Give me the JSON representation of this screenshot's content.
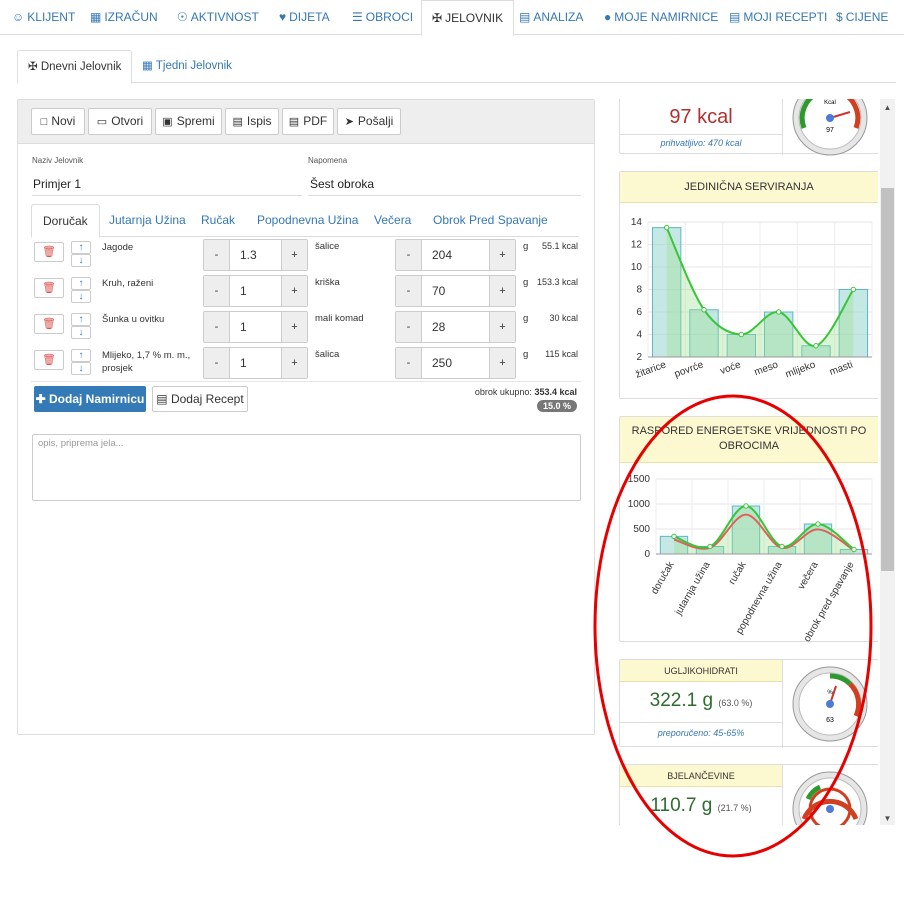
{
  "topnav": [
    {
      "label": "KLIJENT",
      "icon": "user-icon"
    },
    {
      "label": "IZRAČUN",
      "icon": "calculator-icon"
    },
    {
      "label": "AKTIVNOST",
      "icon": "bicycle-icon"
    },
    {
      "label": "DIJETA",
      "icon": "heartbeat-icon"
    },
    {
      "label": "OBROCI",
      "icon": "list-icon"
    },
    {
      "label": "JELOVNIK",
      "icon": "cutlery-icon"
    },
    {
      "label": "ANALIZA",
      "icon": "bar-chart-icon"
    },
    {
      "label": "MOJE NAMIRNICE",
      "icon": "apple-icon"
    },
    {
      "label": "MOJI RECEPTI",
      "icon": "file-icon"
    },
    {
      "label": "CIJENE",
      "icon": "dollar-icon"
    }
  ],
  "subtabs": [
    "Dnevni Jelovnik",
    "Tjedni Jelovnik"
  ],
  "toolbar": {
    "novi": "Novi",
    "otvori": "Otvori",
    "spremi": "Spremi",
    "ispis": "Ispis",
    "pdf": "PDF",
    "posalji": "Pošalji"
  },
  "form": {
    "naziv_label": "Naziv Jelovnik",
    "naziv_value": "Primjer 1",
    "napomena_label": "Napomena",
    "napomena_value": "Šest obroka"
  },
  "meal_tabs": [
    "Doručak",
    "Jutarnja Užina",
    "Ručak",
    "Popodnevna Užina",
    "Večera",
    "Obrok Pred Spavanje"
  ],
  "foods": [
    {
      "name": "Jagode",
      "qty": "1.3",
      "unit": "šalice",
      "grams": "204",
      "g": "g",
      "kcal": "55.1 kcal"
    },
    {
      "name": "Kruh, raženi",
      "qty": "1",
      "unit": "kriška",
      "grams": "70",
      "g": "g",
      "kcal": "153.3 kcal"
    },
    {
      "name": "Šunka u ovitku",
      "qty": "1",
      "unit": "mali komad",
      "grams": "28",
      "g": "g",
      "kcal": "30 kcal"
    },
    {
      "name": "Mlijeko, 1,7 % m. m., prosjek",
      "qty": "1",
      "unit": "šalica",
      "grams": "250",
      "g": "g",
      "kcal": "115 kcal"
    }
  ],
  "step_minus": "-",
  "step_plus": "+",
  "buttons": {
    "add_food": "Dodaj Namirnicu",
    "add_recipe": "Dodaj Recept"
  },
  "total": {
    "label": "obrok ukupno:",
    "value": "353.4 kcal",
    "percent": "15.0 %"
  },
  "notes_placeholder": "opis, priprema jela...",
  "right": {
    "top_card": {
      "value": "97 kcal",
      "note": "prihvatljivo: 470 kcal",
      "gauge_label": "Kcal",
      "gauge_value": "97"
    },
    "servings": {
      "title": "JEDINIČNA SERVIRANJA",
      "chart_data": {
        "type": "bar",
        "categories": [
          "žitarice",
          "povrće",
          "voće",
          "meso",
          "mlijeko",
          "masti"
        ],
        "values": [
          13.5,
          6.2,
          4,
          6,
          3,
          8
        ],
        "ylim": [
          2,
          14
        ],
        "yticks": [
          2,
          4,
          6,
          8,
          10,
          12,
          14
        ]
      }
    },
    "energy": {
      "title": "RASPORED ENERGETSKE VRIJEDNOSTI PO OBROCIMA",
      "chart_data": {
        "type": "bar",
        "categories": [
          "doručak",
          "jutarnja užina",
          "ručak",
          "popodnevna užina",
          "večera",
          "obrok pred spavanje"
        ],
        "values": [
          353,
          150,
          960,
          150,
          600,
          90
        ],
        "ylim": [
          0,
          1500
        ],
        "yticks": [
          0,
          500,
          1000,
          1500
        ]
      }
    },
    "carbs": {
      "title": "UGLJIKOHIDRATI",
      "value": "322.1 g",
      "percent": "(63.0 %)",
      "note": "preporučeno: 45-65%",
      "gauge_label": "%",
      "gauge_value": "63"
    },
    "protein": {
      "title": "BJELANČEVINE",
      "value": "110.7 g",
      "percent": "(21.7 %)"
    }
  },
  "colors": {
    "link": "#3478b5",
    "card_head": "#fcf8d0",
    "bar_fill": "#9fd9d3",
    "line_green": "#3ac43a",
    "line_red": "#e0605a",
    "annotation": "#e60000"
  }
}
